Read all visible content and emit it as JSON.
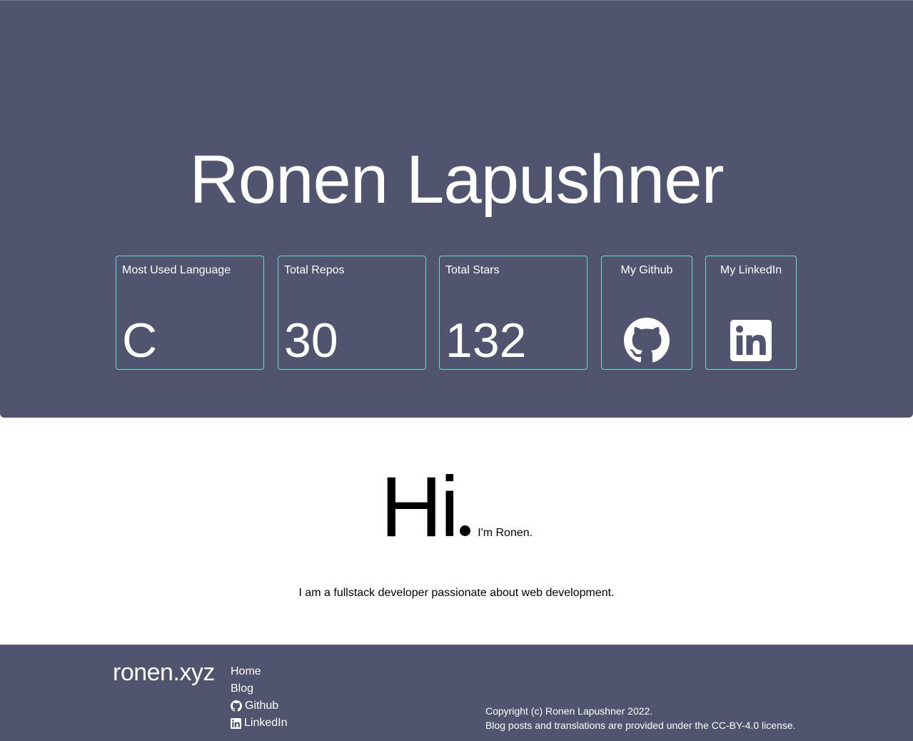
{
  "hero": {
    "title": "Ronen Lapushner",
    "cards": [
      {
        "label": "Most Used Language",
        "value": "C"
      },
      {
        "label": "Total Repos",
        "value": "30"
      },
      {
        "label": "Total Stars",
        "value": "132"
      },
      {
        "label": "My Github",
        "icon": "github-icon"
      },
      {
        "label": "My LinkedIn",
        "icon": "linkedin-icon"
      }
    ]
  },
  "intro": {
    "greeting": "Hi",
    "subtitle": "I'm Ronen.",
    "tagline": "I am a fullstack developer passionate about web development."
  },
  "footer": {
    "brand": "ronen.xyz",
    "nav": [
      {
        "label": "Home"
      },
      {
        "label": "Blog"
      },
      {
        "label": "Github",
        "icon": "github-icon"
      },
      {
        "label": "LinkedIn",
        "icon": "linkedin-icon"
      }
    ],
    "copyright_line1": "Copyright (c) Ronen Lapushner 2022.",
    "copyright_line2": "Blog posts and translations are provided under the CC-BY-4.0 license."
  },
  "colors": {
    "header_bg": "#50546f",
    "card_border": "#6fd8d8",
    "text_light": "#ffffff",
    "text_dark": "#000000"
  }
}
